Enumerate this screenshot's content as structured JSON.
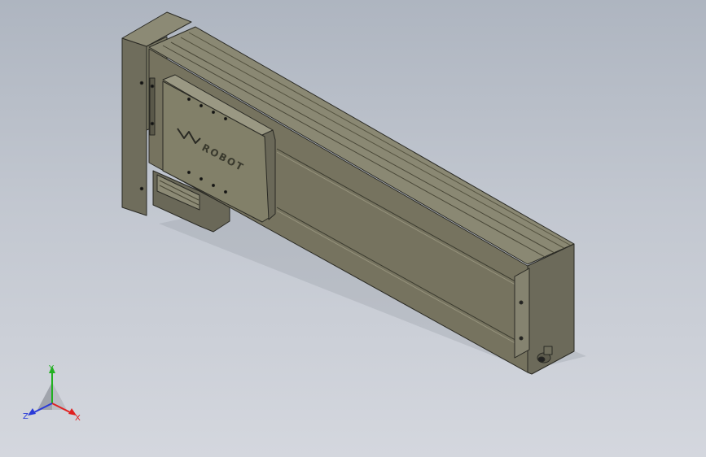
{
  "model": {
    "logo_text": "ROBOT",
    "colors": {
      "background_top": "#aeb5c0",
      "background_bottom": "#d4d7de",
      "body_face": "#76735f",
      "body_top": "#8a8873",
      "end_plate": "#6c6a5a",
      "outline": "#2a2a24"
    }
  },
  "triad": {
    "x_label": "X",
    "y_label": "Y",
    "z_label": "Z",
    "colors": {
      "x": "#e02020",
      "y": "#22b022",
      "z": "#2a3ad8"
    }
  }
}
